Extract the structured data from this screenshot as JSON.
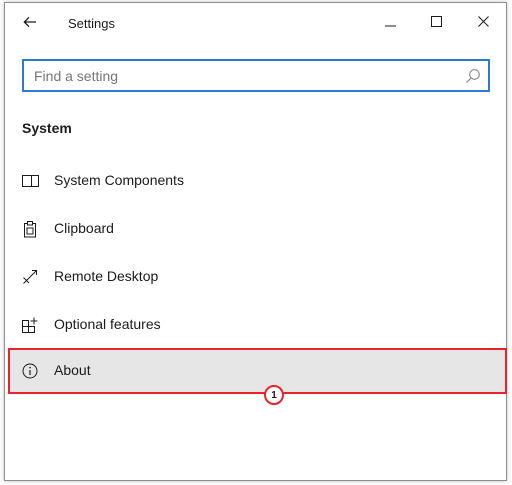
{
  "window": {
    "title": "Settings"
  },
  "search": {
    "placeholder": "Find a setting",
    "value": ""
  },
  "section": {
    "title": "System"
  },
  "nav": {
    "items": [
      {
        "label": "System Components",
        "icon": "system-components-icon"
      },
      {
        "label": "Clipboard",
        "icon": "clipboard-icon"
      },
      {
        "label": "Remote Desktop",
        "icon": "remote-desktop-icon"
      },
      {
        "label": "Optional features",
        "icon": "optional-features-icon"
      },
      {
        "label": "About",
        "icon": "info-icon",
        "selected": true
      }
    ]
  },
  "annotation": {
    "step_number": "1"
  },
  "colors": {
    "accent": "#2b7ad0",
    "highlight": "#e8232b",
    "selected_bg": "#e6e6e6"
  }
}
